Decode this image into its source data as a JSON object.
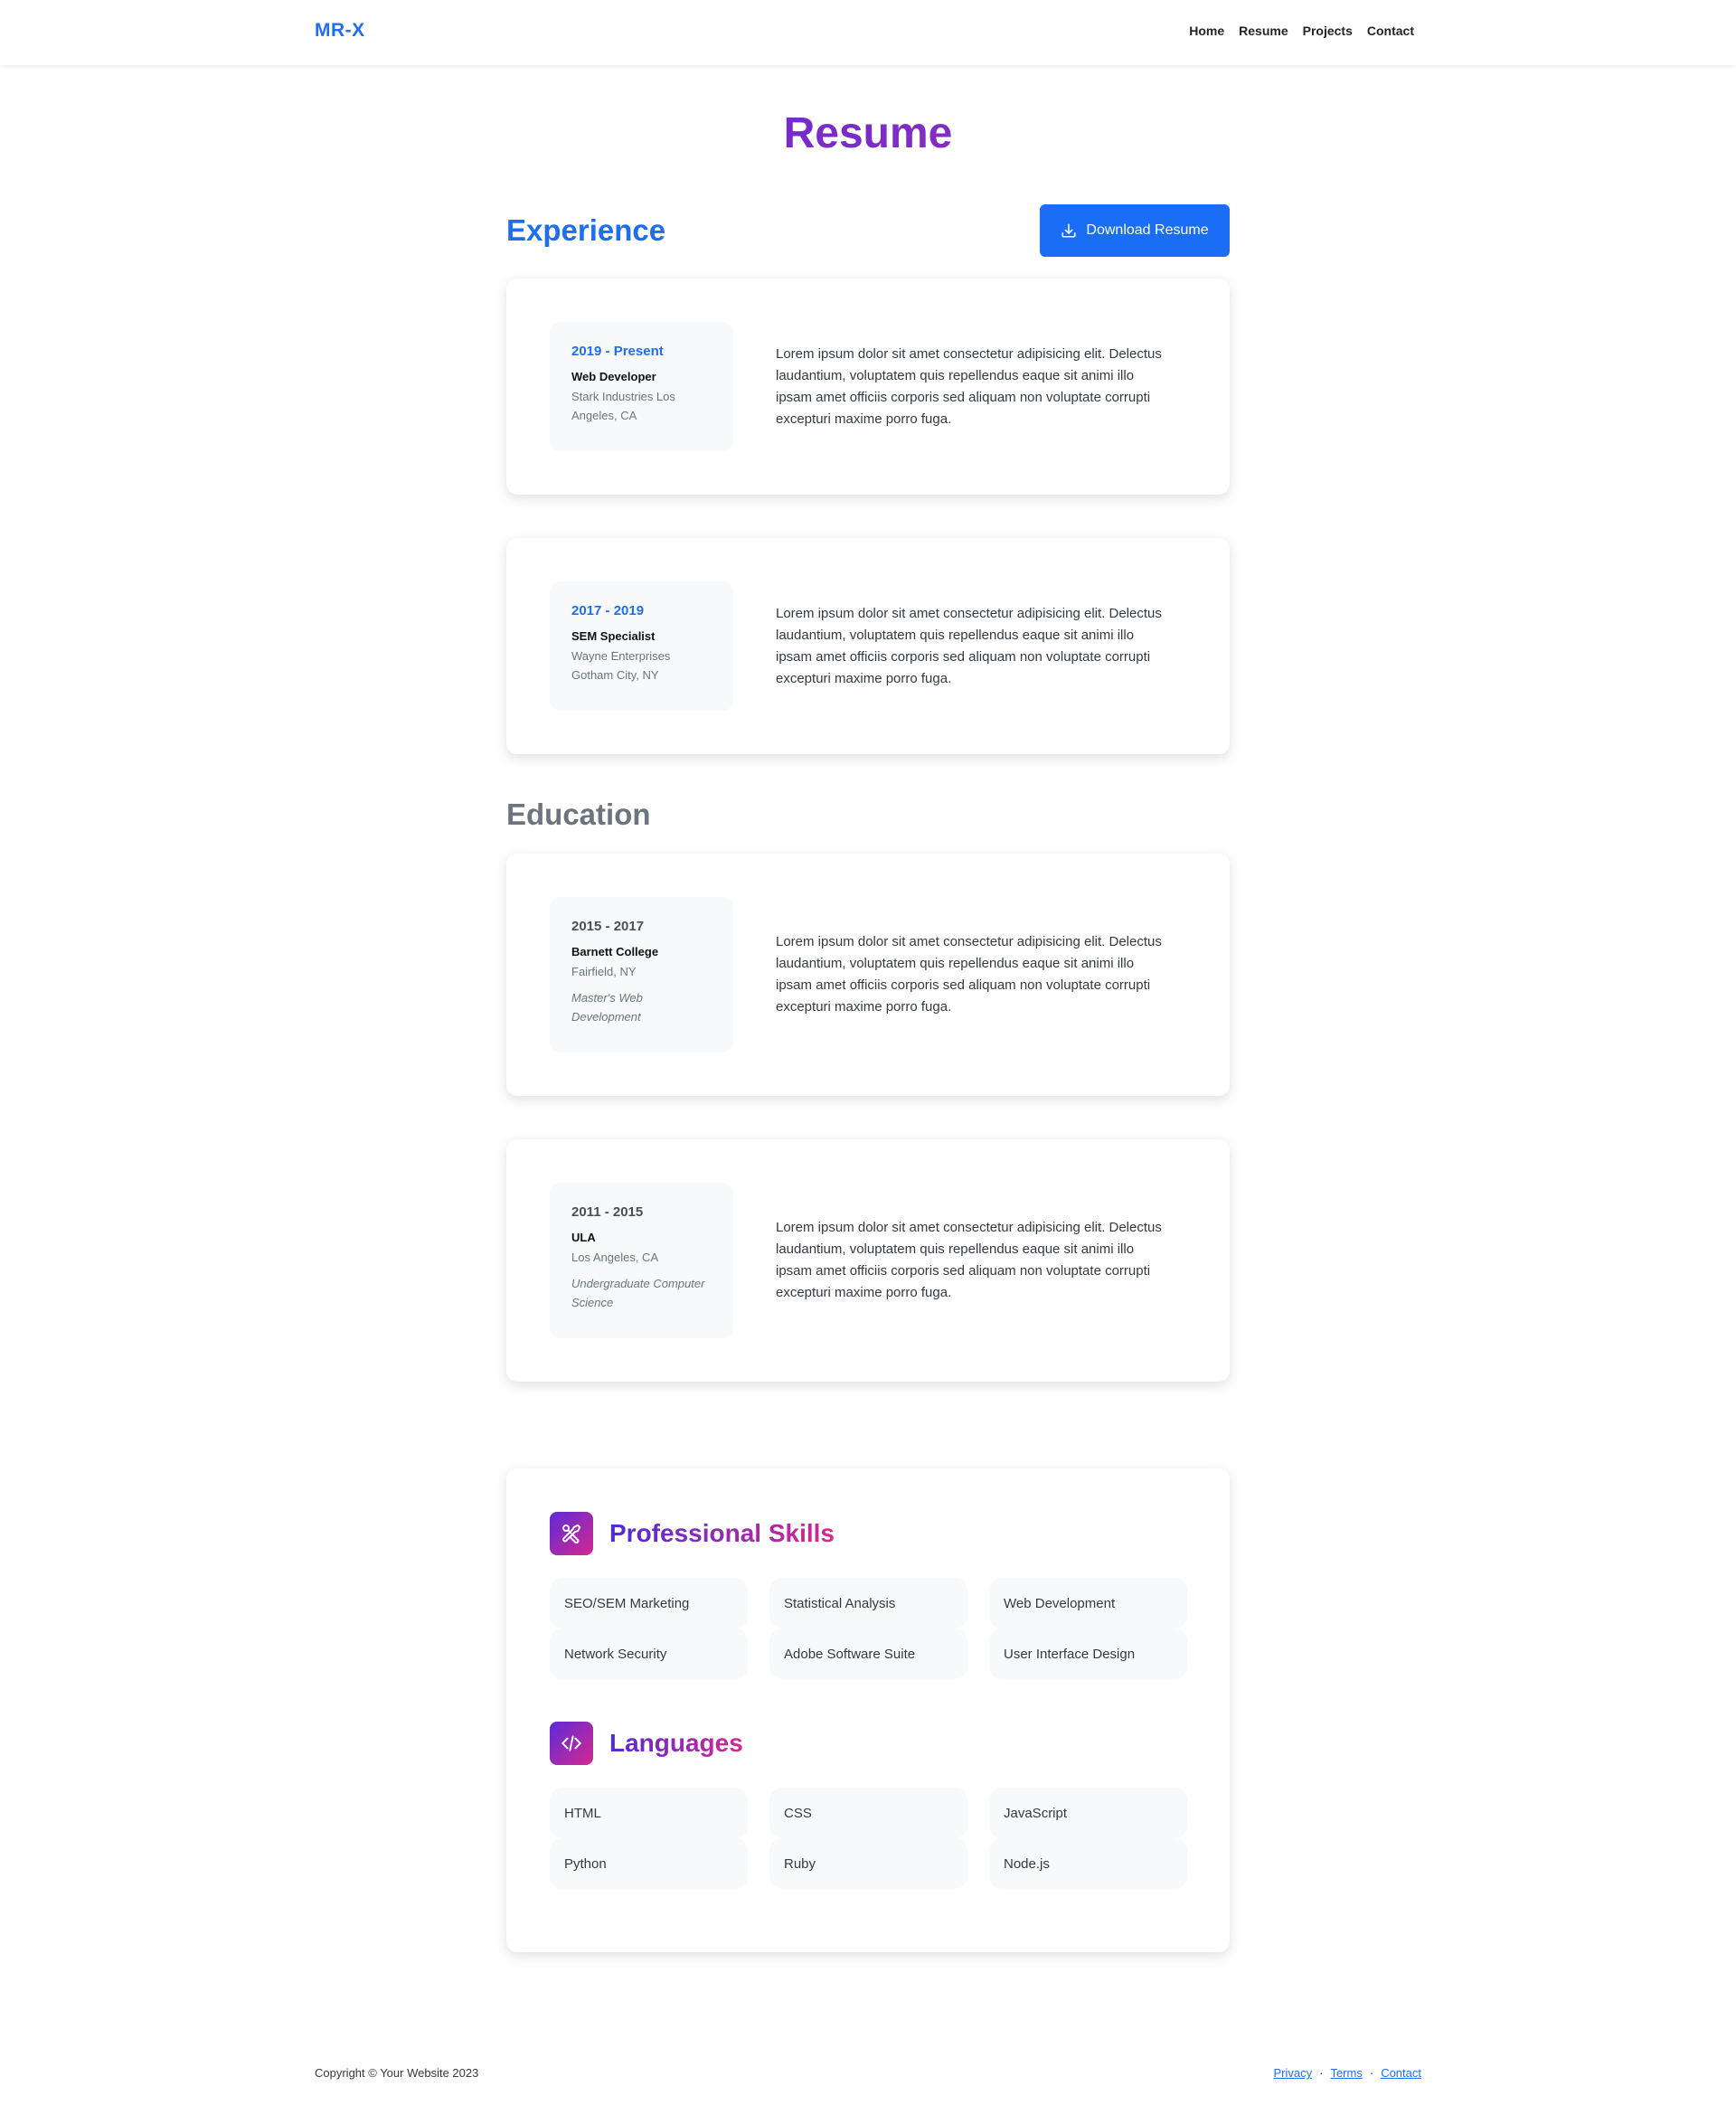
{
  "nav": {
    "brand": "MR-X",
    "links": [
      "Home",
      "Resume",
      "Projects",
      "Contact"
    ]
  },
  "page": {
    "title": "Resume"
  },
  "experience": {
    "heading": "Experience",
    "download_label": "Download Resume",
    "items": [
      {
        "date": "2019 - Present",
        "title": "Web Developer",
        "company": "Stark Industries Los Angeles, CA",
        "description": "Lorem ipsum dolor sit amet consectetur adipisicing elit. Delectus laudantium, voluptatem quis repellendus eaque sit animi illo ipsam amet officiis corporis sed aliquam non voluptate corrupti excepturi maxime porro fuga."
      },
      {
        "date": "2017 - 2019",
        "title": "SEM Specialist",
        "company": "Wayne Enterprises Gotham City, NY",
        "description": "Lorem ipsum dolor sit amet consectetur adipisicing elit. Delectus laudantium, voluptatem quis repellendus eaque sit animi illo ipsam amet officiis corporis sed aliquam non voluptate corrupti excepturi maxime porro fuga."
      }
    ]
  },
  "education": {
    "heading": "Education",
    "items": [
      {
        "date": "2015 - 2017",
        "school": "Barnett College",
        "location": "Fairfield, NY",
        "degree": "Master's Web Development",
        "description": "Lorem ipsum dolor sit amet consectetur adipisicing elit. Delectus laudantium, voluptatem quis repellendus eaque sit animi illo ipsam amet officiis corporis sed aliquam non voluptate corrupti excepturi maxime porro fuga."
      },
      {
        "date": "2011 - 2015",
        "school": "ULA",
        "location": "Los Angeles, CA",
        "degree": "Undergraduate Computer Science",
        "description": "Lorem ipsum dolor sit amet consectetur adipisicing elit. Delectus laudantium, voluptatem quis repellendus eaque sit animi illo ipsam amet officiis corporis sed aliquam non voluptate corrupti excepturi maxime porro fuga."
      }
    ]
  },
  "skills": {
    "heading": "Professional Skills",
    "icon": "tools-icon",
    "items": [
      "SEO/SEM Marketing",
      "Statistical Analysis",
      "Web Development",
      "Network Security",
      "Adobe Software Suite",
      "User Interface Design"
    ]
  },
  "languages": {
    "heading": "Languages",
    "icon": "code-icon",
    "items": [
      "HTML",
      "CSS",
      "JavaScript",
      "Python",
      "Ruby",
      "Node.js"
    ]
  },
  "footer": {
    "copyright": "Copyright © Your Website 2023",
    "links": [
      "Privacy",
      "Terms",
      "Contact"
    ],
    "separator": "·"
  },
  "colors": {
    "accent": "#1e6ff0",
    "gradient_start": "#4f2bd8",
    "gradient_end": "#d6288f"
  }
}
